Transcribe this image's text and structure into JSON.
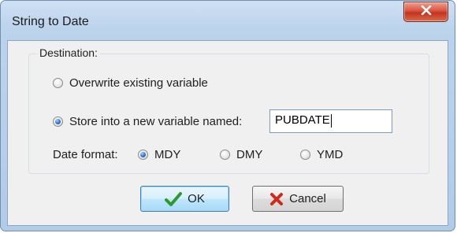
{
  "window": {
    "title": "String to Date",
    "close_icon": "close-icon"
  },
  "destination": {
    "legend": "Destination:",
    "options": [
      {
        "label": "Overwrite existing variable",
        "selected": false
      },
      {
        "label": "Store into a new variable named:",
        "selected": true
      }
    ],
    "variable_name": "PUBDATE"
  },
  "date_format": {
    "label": "Date format:",
    "options": [
      {
        "label": "MDY",
        "selected": true
      },
      {
        "label": "DMY",
        "selected": false
      },
      {
        "label": "YMD",
        "selected": false
      }
    ]
  },
  "buttons": {
    "ok": {
      "label": "OK",
      "icon": "checkmark-icon"
    },
    "cancel": {
      "label": "Cancel",
      "icon": "x-icon"
    }
  },
  "colors": {
    "accent": "#3c7fb1",
    "close_red": "#c2331f",
    "check_green": "#2e9a2e",
    "cancel_red": "#cc2a1a"
  }
}
